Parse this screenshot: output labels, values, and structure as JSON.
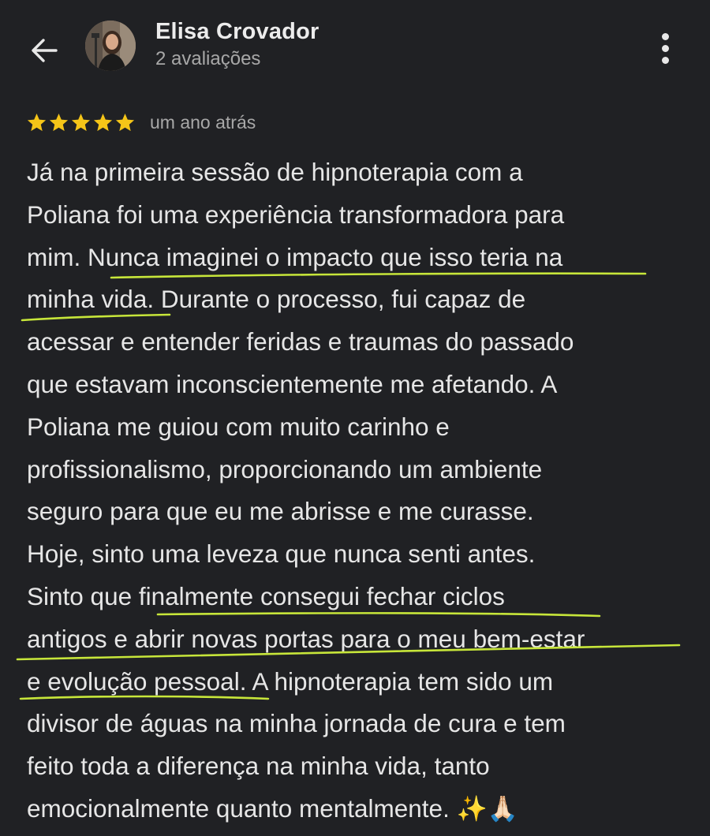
{
  "header": {
    "author_name": "Elisa Crovador",
    "author_meta": "2 avaliações"
  },
  "review": {
    "rating": 5,
    "rating_max": 5,
    "date": "um ano atrás",
    "lines": [
      "Já na primeira sessão de hipnoterapia com a",
      "Poliana foi uma experiência transformadora para",
      "mim. Nunca imaginei o impacto que isso teria na",
      "minha vida. Durante o processo, fui capaz de",
      "acessar e entender feridas e traumas do passado",
      "que estavam inconscientemente me afetando. A",
      "Poliana me guiou com muito carinho e",
      "profissionalismo, proporcionando um ambiente",
      "seguro para que eu me abrisse e me curasse.",
      "Hoje, sinto uma leveza que nunca senti antes.",
      "Sinto que finalmente consegui fechar ciclos",
      "antigos e abrir novas portas para o meu bem-estar",
      "e evolução pessoal. A hipnoterapia tem sido um",
      "divisor de águas na minha jornada de cura e tem",
      "feito toda a diferença na minha vida, tanto",
      "emocionalmente quanto mentalmente."
    ],
    "end_emojis": {
      "sparkles": "✨",
      "hands": "🙏🏻"
    }
  },
  "colors": {
    "background": "#202124",
    "star": "#f5c518",
    "underline": "#c7e63a"
  },
  "icons": {
    "back": "arrow-left-icon",
    "more": "more-vertical-icon",
    "star": "star-icon"
  }
}
